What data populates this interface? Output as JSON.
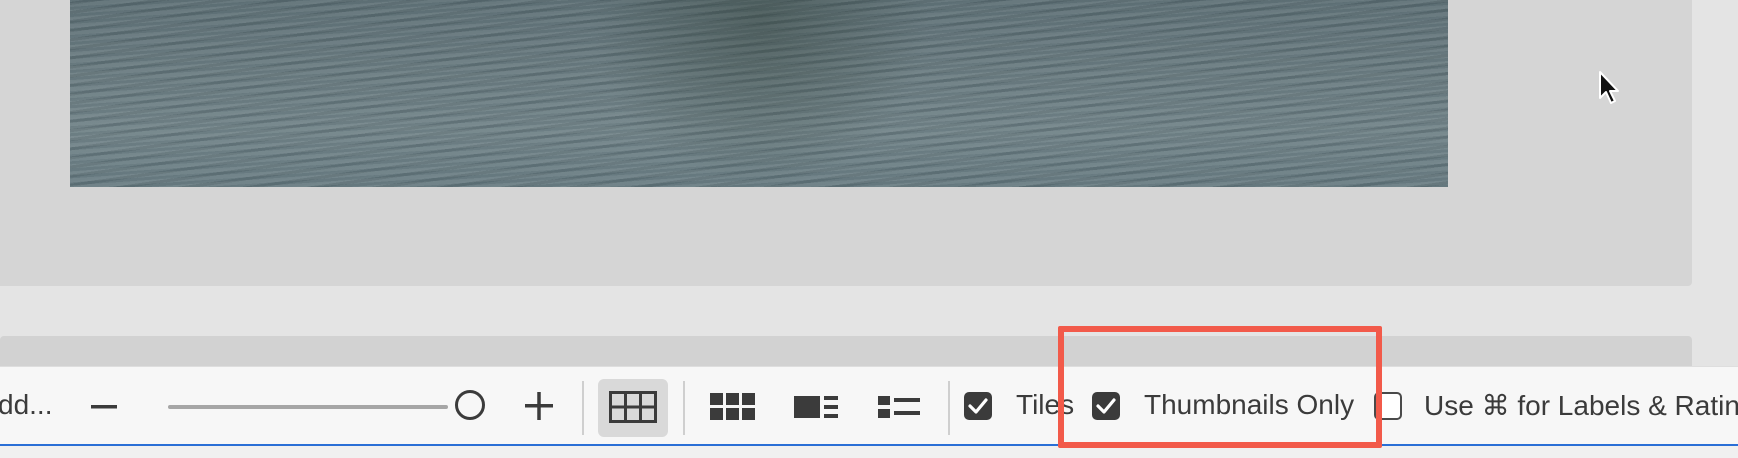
{
  "toolbar": {
    "truncated_label": "dd...",
    "tiles_label": "Tiles",
    "tiles_checked": true,
    "thumbnails_only_label": "Thumbnails Only",
    "thumbnails_only_checked": true,
    "labels_ratings_label": "Use ⌘ for Labels & Rating",
    "labels_ratings_checked": false,
    "view_modes": [
      "grid-view-icon",
      "grid-thumbnails-icon",
      "details-view-icon",
      "list-view-icon"
    ],
    "active_view": "grid-view-icon",
    "zoom_slider_level": 1.0
  },
  "colors": {
    "highlight": "#f25a4a",
    "toolbar_bg": "#f7f7f7",
    "panel_bg": "#d5d5d5",
    "accent_line": "#2a6fd6"
  }
}
